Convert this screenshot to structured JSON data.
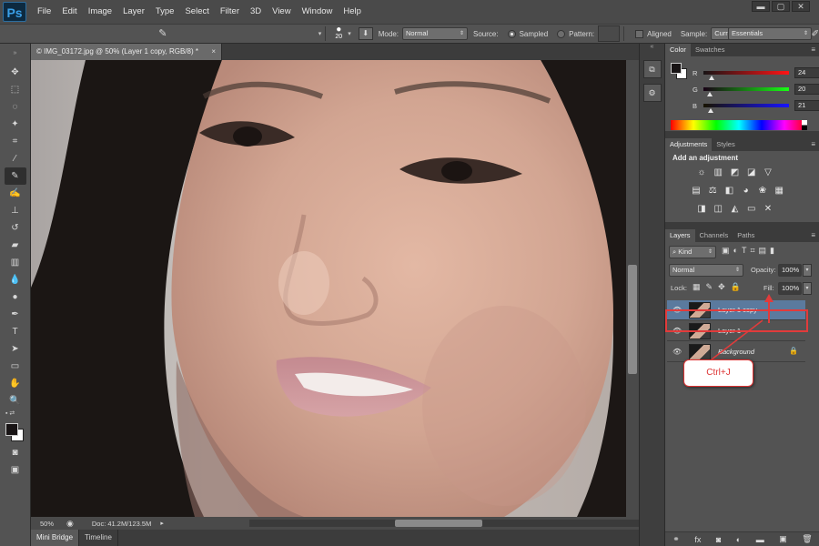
{
  "app": {
    "logo": "Ps"
  },
  "menu": {
    "items": [
      "File",
      "Edit",
      "Image",
      "Layer",
      "Type",
      "Select",
      "Filter",
      "3D",
      "View",
      "Window",
      "Help"
    ]
  },
  "window_controls": {
    "minimize": "▬",
    "restore": "▢",
    "close": "✕"
  },
  "options": {
    "brush_size": "20",
    "mode_label": "Mode:",
    "mode_value": "Normal",
    "source_label": "Source:",
    "sampled_label": "Sampled",
    "pattern_label": "Pattern:",
    "aligned_label": "Aligned",
    "sample_label": "Sample:",
    "sample_value": "Current Layer",
    "workspace": "Essentials"
  },
  "document": {
    "tab_title": "© IMG_03172.jpg @ 50% (Layer 1 copy, RGB/8) *",
    "close": "×",
    "zoom": "50%",
    "doc_info": "Doc: 41.2M/123.5M"
  },
  "bottom_tabs": [
    "Mini Bridge",
    "Timeline"
  ],
  "color_panel": {
    "tabs": [
      "Color",
      "Swatches"
    ],
    "channels": [
      {
        "label": "R",
        "value": "24",
        "fraction": 0.094
      },
      {
        "label": "G",
        "value": "20",
        "fraction": 0.078
      },
      {
        "label": "B",
        "value": "21",
        "fraction": 0.082
      }
    ],
    "colors": {
      "foreground": "#181415",
      "background": "#ffffff"
    }
  },
  "adjustments_panel": {
    "tabs": [
      "Adjustments",
      "Styles"
    ],
    "title": "Add an adjustment",
    "row1_icons": [
      "brightness-contrast-icon",
      "levels-icon",
      "curves-icon",
      "exposure-icon",
      "vibrance-icon"
    ],
    "row2_icons": [
      "hue-saturation-icon",
      "color-balance-icon",
      "black-white-icon",
      "photo-filter-icon",
      "channel-mixer-icon",
      "color-lookup-icon"
    ],
    "row3_icons": [
      "invert-icon",
      "posterize-icon",
      "threshold-icon",
      "selective-color-icon",
      "gradient-map-icon"
    ]
  },
  "layers_panel": {
    "tabs": [
      "Layers",
      "Channels",
      "Paths"
    ],
    "kind_label": "Kind",
    "blend_mode": "Normal",
    "opacity_label": "Opacity:",
    "opacity_value": "100%",
    "lock_label": "Lock:",
    "fill_label": "Fill:",
    "fill_value": "100%",
    "layers": [
      {
        "name": "Layer 1 copy",
        "selected": true,
        "italic": false,
        "locked": false
      },
      {
        "name": "Layer 1",
        "selected": false,
        "italic": false,
        "locked": false
      },
      {
        "name": "Background",
        "selected": false,
        "italic": true,
        "locked": true
      }
    ]
  },
  "annotation": {
    "callout_text": "Ctrl+J"
  }
}
